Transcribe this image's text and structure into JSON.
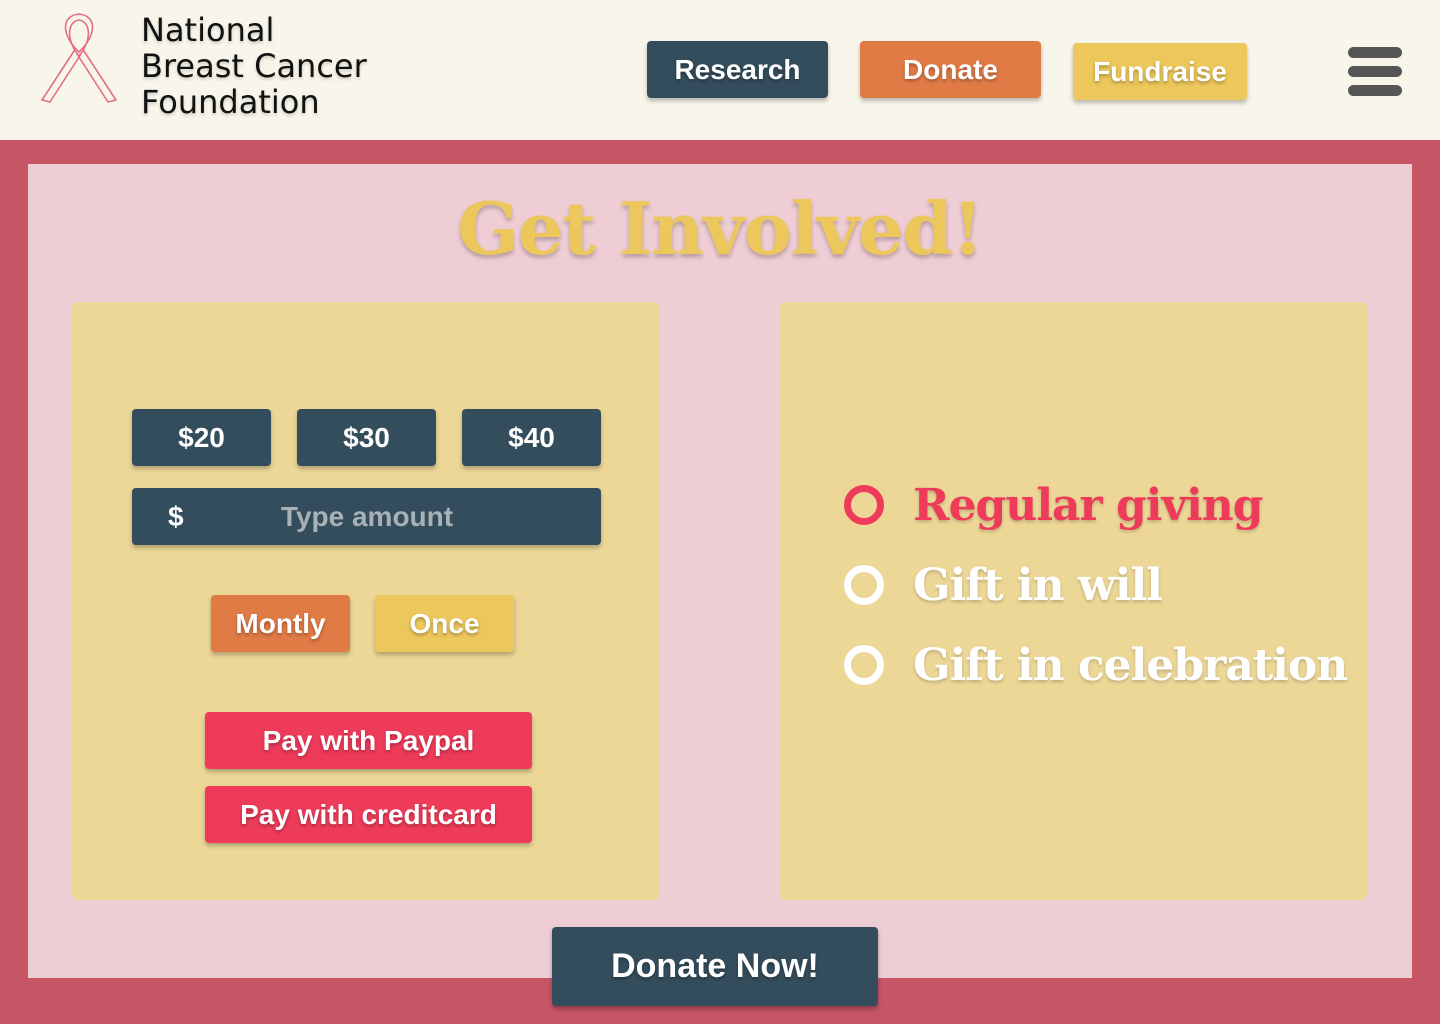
{
  "header": {
    "org_name": {
      "line1": "National",
      "line2": "Breast Cancer",
      "line3": "Foundation"
    },
    "logo_icon": "pink-ribbon-icon",
    "nav": {
      "research": "Research",
      "donate": "Donate",
      "fundraise": "Fundraise"
    },
    "menu_icon": "hamburger-menu-icon"
  },
  "main": {
    "title": "Get Involved!",
    "donation": {
      "amounts": [
        "$20",
        "$30",
        "$40"
      ],
      "currency_symbol": "$",
      "amount_placeholder": "Type amount",
      "amount_value": "",
      "frequency": {
        "monthly": "Montly",
        "once": "Once"
      },
      "pay_paypal": "Pay with Paypal",
      "pay_creditcard": "Pay with creditcard"
    },
    "giving_options": {
      "selected": "Regular giving",
      "items": [
        "Regular giving",
        "Gift in will",
        "Gift in celebration"
      ]
    },
    "donate_now": "Donate Now!"
  },
  "colors": {
    "background": "#c85566",
    "header_bg": "#f8f6ea",
    "panel_bg": "#efcdd4",
    "card_bg": "#ecd797",
    "dark_blue": "#344d5c",
    "orange": "#e07b45",
    "yellow": "#ecc75b",
    "pink_red": "#ef3b5a"
  }
}
